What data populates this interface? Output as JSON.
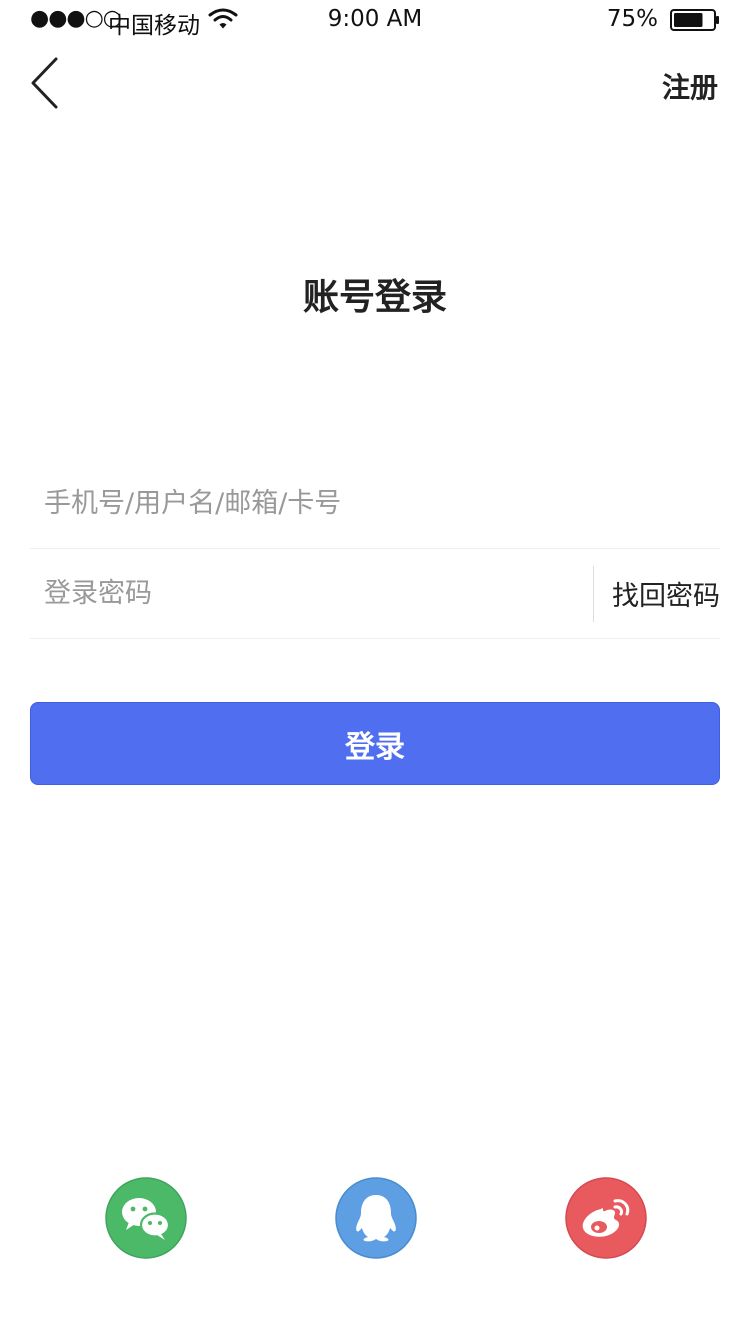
{
  "status_bar": {
    "signal": "●●●○○",
    "carrier": "中国移动",
    "time": "9:00 AM",
    "battery_percent": "75%",
    "battery_level": 0.75,
    "wifi_icon": "wifi-icon",
    "battery_icon": "battery-icon"
  },
  "nav": {
    "back_icon": "chevron-left-icon",
    "register_label": "注册"
  },
  "page_title": "账号登录",
  "form": {
    "username_placeholder": "手机号/用户名/邮箱/卡号",
    "username_value": "",
    "password_placeholder": "登录密码",
    "password_value": "",
    "forgot_label": "找回密码",
    "login_label": "登录"
  },
  "social_login": [
    {
      "icon": "wechat-icon",
      "color": "#4cb969"
    },
    {
      "icon": "qq-icon",
      "color": "#5d9fe2"
    },
    {
      "icon": "weibo-icon",
      "color": "#e85a5e"
    }
  ],
  "colors": {
    "accent": "#4f6ef0",
    "text": "#222222",
    "placeholder": "#999999",
    "divider": "#eeeeee"
  }
}
